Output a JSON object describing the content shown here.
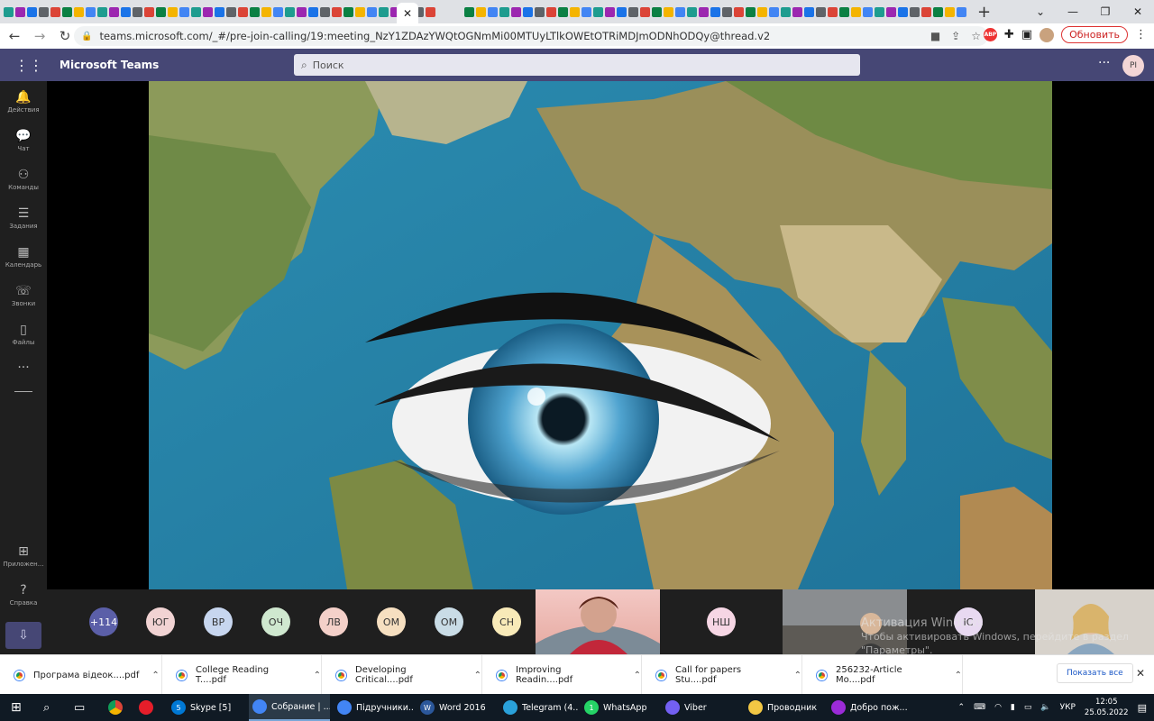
{
  "browser": {
    "url": "teams.microsoft.com/_#/pre-join-calling/19:meeting_NzY1ZDAzYWQtOGNmMi00MTUyLTlkOWEtOTRiMDJmODNhODQy@thread.v2",
    "update_label": "Обновить",
    "abp_label": "ABP"
  },
  "teams": {
    "app_name": "Microsoft Teams",
    "search_placeholder": "Поиск",
    "user_initials": "PI",
    "rail": [
      {
        "label": "Действия",
        "icon": "bell-icon"
      },
      {
        "label": "Чат",
        "icon": "chat-icon"
      },
      {
        "label": "Команды",
        "icon": "teams-icon"
      },
      {
        "label": "Задания",
        "icon": "assignments-icon"
      },
      {
        "label": "Календарь",
        "icon": "calendar-icon"
      },
      {
        "label": "Звонки",
        "icon": "phone-icon"
      },
      {
        "label": "Файлы",
        "icon": "files-icon"
      }
    ],
    "rail_bottom": [
      {
        "label": "Приложен...",
        "icon": "apps-icon"
      },
      {
        "label": "Справка",
        "icon": "help-icon"
      }
    ]
  },
  "participants": [
    {
      "initials": "+114",
      "color": "#5b5fa8",
      "text": "#ffffff"
    },
    {
      "initials": "ЮГ",
      "color": "#f1d3d3",
      "text": "#333333"
    },
    {
      "initials": "ВР",
      "color": "#c7d6ef",
      "text": "#333333"
    },
    {
      "initials": "ОЧ",
      "color": "#cfe8cf",
      "text": "#333333"
    },
    {
      "initials": "ЛВ",
      "color": "#f4d0c9",
      "text": "#333333"
    },
    {
      "initials": "ОМ",
      "color": "#f6dfc0",
      "text": "#333333"
    },
    {
      "initials": "ОМ",
      "color": "#c9dce6",
      "text": "#333333"
    },
    {
      "initials": "СН",
      "color": "#f8eab8",
      "text": "#333333"
    },
    {
      "initials": "НШ",
      "color": "#f6d6e4",
      "text": "#333333"
    },
    {
      "initials": "ІС",
      "color": "#e8d9f1",
      "text": "#333333"
    }
  ],
  "windows_activation": {
    "line1": "Активация Windows",
    "line2": "Чтобы активировать Windows, перейдите в раздел",
    "line3": "\"Параметры\"."
  },
  "downloads": {
    "items": [
      "Програма відеок....pdf",
      "College Reading T....pdf",
      "Developing Critical....pdf",
      "Improving Readin....pdf",
      "Call for papers Stu....pdf",
      "256232-Article Mo....pdf"
    ],
    "show_all": "Показать все"
  },
  "taskbar": {
    "apps": [
      {
        "label": "Skype [5]",
        "color": "#0078d4",
        "badge": "5"
      },
      {
        "label": "Собрание | ...",
        "color": "#4285f4",
        "badge": ""
      },
      {
        "label": "Підручники...",
        "color": "#4285f4",
        "badge": ""
      },
      {
        "label": "Word 2016",
        "color": "#2b579a",
        "badge": "W"
      },
      {
        "label": "Telegram (4...",
        "color": "#2aa1da",
        "badge": ""
      },
      {
        "label": "WhatsApp",
        "color": "#25d366",
        "badge": "1"
      },
      {
        "label": "Viber",
        "color": "#7360f2",
        "badge": ""
      },
      {
        "label": "Проводник",
        "color": "#f2c744",
        "badge": ""
      },
      {
        "label": "Добро пож...",
        "color": "#9b2bd8",
        "badge": ""
      }
    ],
    "lang": "УКР",
    "time": "12:05",
    "date": "25.05.2022"
  }
}
